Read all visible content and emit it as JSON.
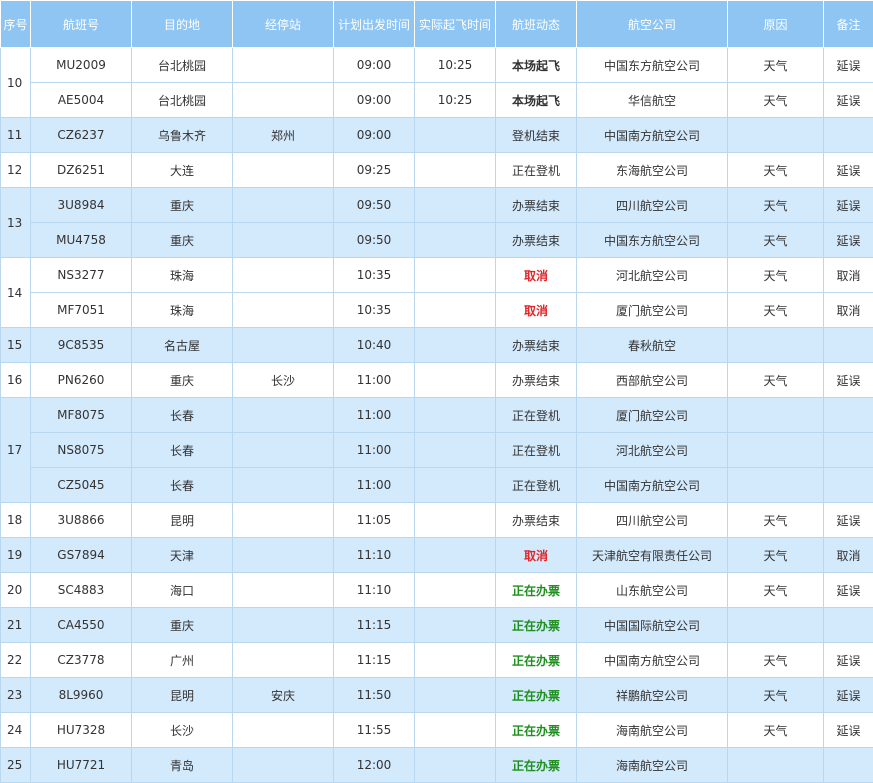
{
  "table": {
    "headers": [
      "序号",
      "航班号",
      "目的地",
      "经停站",
      "计划出发时间",
      "实际起飞时间",
      "航班动态",
      "航空公司",
      "原因",
      "备注"
    ],
    "groups": [
      {
        "seq": "10",
        "rows": [
          {
            "flight": "MU2009",
            "dest": "台北桃园",
            "stop": "",
            "planned": "09:00",
            "actual": "10:25",
            "status": "本场起飞",
            "status_style": "bold",
            "airline": "中国东方航空公司",
            "reason": "天气",
            "remark": "延误"
          },
          {
            "flight": "AE5004",
            "dest": "台北桃园",
            "stop": "",
            "planned": "09:00",
            "actual": "10:25",
            "status": "本场起飞",
            "status_style": "bold",
            "airline": "华信航空",
            "reason": "天气",
            "remark": "延误"
          }
        ]
      },
      {
        "seq": "11",
        "rows": [
          {
            "flight": "CZ6237",
            "dest": "乌鲁木齐",
            "stop": "郑州",
            "planned": "09:00",
            "actual": "",
            "status": "登机结束",
            "status_style": "normal",
            "airline": "中国南方航空公司",
            "reason": "",
            "remark": ""
          }
        ]
      },
      {
        "seq": "12",
        "rows": [
          {
            "flight": "DZ6251",
            "dest": "大连",
            "stop": "",
            "planned": "09:25",
            "actual": "",
            "status": "正在登机",
            "status_style": "normal",
            "airline": "东海航空公司",
            "reason": "天气",
            "remark": "延误"
          }
        ]
      },
      {
        "seq": "13",
        "rows": [
          {
            "flight": "3U8984",
            "dest": "重庆",
            "stop": "",
            "planned": "09:50",
            "actual": "",
            "status": "办票结束",
            "status_style": "normal",
            "airline": "四川航空公司",
            "reason": "天气",
            "remark": "延误"
          },
          {
            "flight": "MU4758",
            "dest": "重庆",
            "stop": "",
            "planned": "09:50",
            "actual": "",
            "status": "办票结束",
            "status_style": "normal",
            "airline": "中国东方航空公司",
            "reason": "天气",
            "remark": "延误"
          }
        ]
      },
      {
        "seq": "14",
        "rows": [
          {
            "flight": "NS3277",
            "dest": "珠海",
            "stop": "",
            "planned": "10:35",
            "actual": "",
            "status": "取消",
            "status_style": "red",
            "airline": "河北航空公司",
            "reason": "天气",
            "remark": "取消"
          },
          {
            "flight": "MF7051",
            "dest": "珠海",
            "stop": "",
            "planned": "10:35",
            "actual": "",
            "status": "取消",
            "status_style": "red",
            "airline": "厦门航空公司",
            "reason": "天气",
            "remark": "取消"
          }
        ]
      },
      {
        "seq": "15",
        "rows": [
          {
            "flight": "9C8535",
            "dest": "名古屋",
            "stop": "",
            "planned": "10:40",
            "actual": "",
            "status": "办票结束",
            "status_style": "normal",
            "airline": "春秋航空",
            "reason": "",
            "remark": ""
          }
        ]
      },
      {
        "seq": "16",
        "rows": [
          {
            "flight": "PN6260",
            "dest": "重庆",
            "stop": "长沙",
            "planned": "11:00",
            "actual": "",
            "status": "办票结束",
            "status_style": "normal",
            "airline": "西部航空公司",
            "reason": "天气",
            "remark": "延误"
          }
        ]
      },
      {
        "seq": "17",
        "rows": [
          {
            "flight": "MF8075",
            "dest": "长春",
            "stop": "",
            "planned": "11:00",
            "actual": "",
            "status": "正在登机",
            "status_style": "normal",
            "airline": "厦门航空公司",
            "reason": "",
            "remark": ""
          },
          {
            "flight": "NS8075",
            "dest": "长春",
            "stop": "",
            "planned": "11:00",
            "actual": "",
            "status": "正在登机",
            "status_style": "normal",
            "airline": "河北航空公司",
            "reason": "",
            "remark": ""
          },
          {
            "flight": "CZ5045",
            "dest": "长春",
            "stop": "",
            "planned": "11:00",
            "actual": "",
            "status": "正在登机",
            "status_style": "normal",
            "airline": "中国南方航空公司",
            "reason": "",
            "remark": ""
          }
        ]
      },
      {
        "seq": "18",
        "rows": [
          {
            "flight": "3U8866",
            "dest": "昆明",
            "stop": "",
            "planned": "11:05",
            "actual": "",
            "status": "办票结束",
            "status_style": "normal",
            "airline": "四川航空公司",
            "reason": "天气",
            "remark": "延误"
          }
        ]
      },
      {
        "seq": "19",
        "rows": [
          {
            "flight": "GS7894",
            "dest": "天津",
            "stop": "",
            "planned": "11:10",
            "actual": "",
            "status": "取消",
            "status_style": "red",
            "airline": "天津航空有限责任公司",
            "reason": "天气",
            "remark": "取消"
          }
        ]
      },
      {
        "seq": "20",
        "rows": [
          {
            "flight": "SC4883",
            "dest": "海口",
            "stop": "",
            "planned": "11:10",
            "actual": "",
            "status": "正在办票",
            "status_style": "green",
            "airline": "山东航空公司",
            "reason": "天气",
            "remark": "延误"
          }
        ]
      },
      {
        "seq": "21",
        "rows": [
          {
            "flight": "CA4550",
            "dest": "重庆",
            "stop": "",
            "planned": "11:15",
            "actual": "",
            "status": "正在办票",
            "status_style": "green",
            "airline": "中国国际航空公司",
            "reason": "",
            "remark": ""
          }
        ]
      },
      {
        "seq": "22",
        "rows": [
          {
            "flight": "CZ3778",
            "dest": "广州",
            "stop": "",
            "planned": "11:15",
            "actual": "",
            "status": "正在办票",
            "status_style": "green",
            "airline": "中国南方航空公司",
            "reason": "天气",
            "remark": "延误"
          }
        ]
      },
      {
        "seq": "23",
        "rows": [
          {
            "flight": "8L9960",
            "dest": "昆明",
            "stop": "安庆",
            "planned": "11:50",
            "actual": "",
            "status": "正在办票",
            "status_style": "green",
            "airline": "祥鹏航空公司",
            "reason": "天气",
            "remark": "延误"
          }
        ]
      },
      {
        "seq": "24",
        "rows": [
          {
            "flight": "HU7328",
            "dest": "长沙",
            "stop": "",
            "planned": "11:55",
            "actual": "",
            "status": "正在办票",
            "status_style": "green",
            "airline": "海南航空公司",
            "reason": "天气",
            "remark": "延误"
          }
        ]
      },
      {
        "seq": "25",
        "rows": [
          {
            "flight": "HU7721",
            "dest": "青岛",
            "stop": "",
            "planned": "12:00",
            "actual": "",
            "status": "正在办票",
            "status_style": "green",
            "airline": "海南航空公司",
            "reason": "",
            "remark": ""
          }
        ]
      }
    ]
  }
}
